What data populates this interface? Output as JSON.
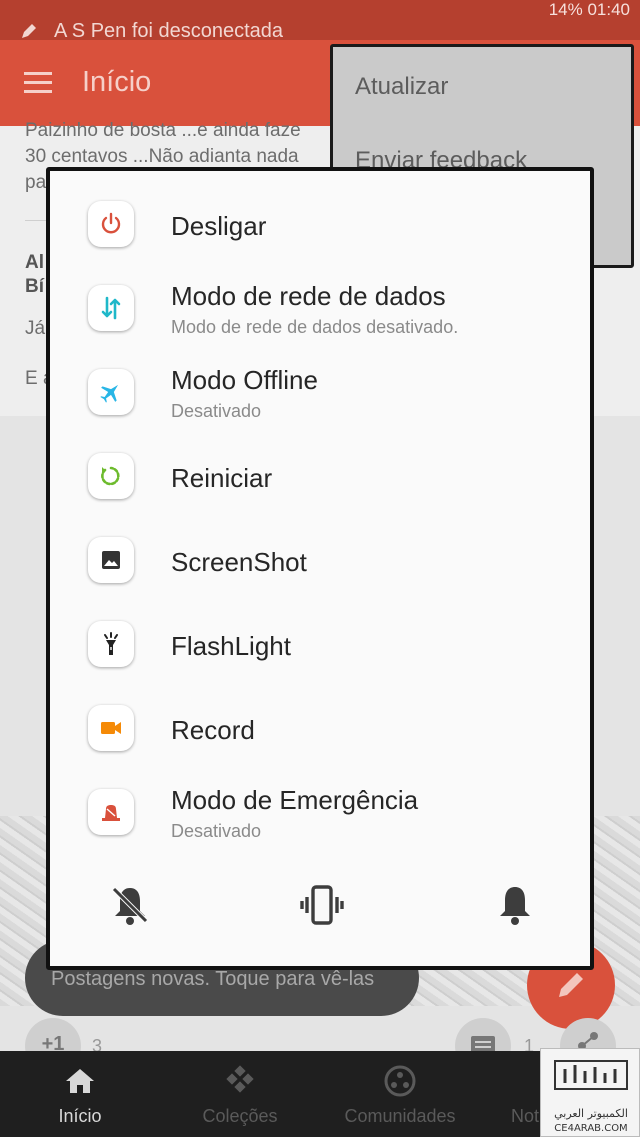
{
  "status_bar": {
    "notification": "A S Pen foi desconectada",
    "right_info": "14% 01:40"
  },
  "app_bar": {
    "title": "Início"
  },
  "overflow_menu": {
    "items": [
      "Atualizar",
      "Enviar feedback"
    ]
  },
  "feed": {
    "post1_line1": "Paizinho de bosta ...e ainda faze",
    "post1_line2": "30 centavos ...Não adianta nada",
    "post1_line3": "pa",
    "post2_title1": "Al",
    "post2_title2": "Bí",
    "post2_line1": "Já",
    "post2_line2": "E a"
  },
  "power_menu": {
    "options": [
      {
        "title": "Desligar",
        "subtitle": "",
        "icon": "power-icon",
        "color": "#d9513c"
      },
      {
        "title": "Modo de rede de dados",
        "subtitle": "Modo de rede de dados desativado.",
        "icon": "mobile-data-icon",
        "color": "#1fb8c9"
      },
      {
        "title": "Modo Offline",
        "subtitle": "Desativado",
        "icon": "airplane-icon",
        "color": "#29b6e6"
      },
      {
        "title": "Reiniciar",
        "subtitle": "",
        "icon": "restart-icon",
        "color": "#6dbb2d"
      },
      {
        "title": "ScreenShot",
        "subtitle": "",
        "icon": "screenshot-icon",
        "color": "#333333"
      },
      {
        "title": "FlashLight",
        "subtitle": "",
        "icon": "flashlight-icon",
        "color": "#222222"
      },
      {
        "title": "Record",
        "subtitle": "",
        "icon": "record-icon",
        "color": "#f58a07"
      },
      {
        "title": "Modo de Emergência",
        "subtitle": "Desativado",
        "icon": "emergency-icon",
        "color": "#d9513c"
      }
    ],
    "sound_modes": [
      "mute-icon",
      "vibrate-icon",
      "sound-icon"
    ]
  },
  "snackbar": {
    "text": "Postagens novas. Toque para vê-las"
  },
  "actions": {
    "plus_one": "+1",
    "plus_count": "3",
    "comment_count": "1"
  },
  "bottom_nav": {
    "items": [
      {
        "label": "Início",
        "icon": "home-icon",
        "active": true
      },
      {
        "label": "Coleções",
        "icon": "collections-icon",
        "active": false
      },
      {
        "label": "Comunidades",
        "icon": "communities-icon",
        "active": false
      },
      {
        "label": "Notificações",
        "icon": "bell-icon",
        "active": false
      }
    ]
  },
  "watermark": {
    "line1": "الكمبيوتر العربي",
    "line2": "CE4ARAB.COM"
  }
}
